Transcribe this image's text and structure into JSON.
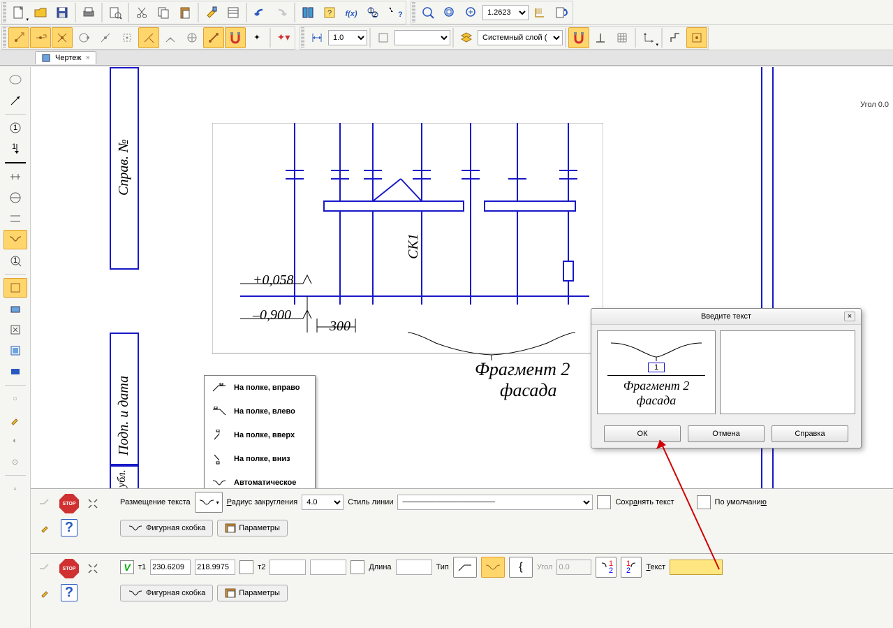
{
  "zoom_value": "1.2623",
  "linewidth_value": "1.0",
  "layer_value": "Системный слой (",
  "doc_tab": "Чертеж",
  "angle_text": "Угол 0.0",
  "drawing": {
    "label_ck1": "СК1",
    "elev1": "+0,058",
    "elev2": "–0,900",
    "dim300": "300",
    "fragment_l1": "Фрагмент 2",
    "fragment_l2": "фасада",
    "titlebox_sprav": "Справ. №",
    "titlebox_podp": "Подп. и дата",
    "titlebox_ubl": "убл."
  },
  "popup": {
    "i1": "На полке, вправо",
    "i2": "На полке, влево",
    "i3": "На полке, вверх",
    "i4": "На полке, вниз",
    "i5": "Автоматическое"
  },
  "panel1": {
    "razm": "Размещение текста",
    "radius_label": "Радиус закругления",
    "radius_val": "4.0",
    "style_label": "Стиль линии",
    "save_text": "Сохранять текст",
    "default": "По умолчанию",
    "tab1": "Фигурная скобка",
    "tab2": "Параметры"
  },
  "panel2": {
    "t1_label": "т1",
    "t1_x": "230.6209",
    "t1_y": "218.9975",
    "t2_label": "т2",
    "dlina": "Длина",
    "tip": "Тип",
    "ugol": "Угол",
    "ugol_val": "0.0",
    "text_label": "Текст",
    "tab1": "Фигурная скобка",
    "tab2": "Параметры"
  },
  "dialog": {
    "title": "Введите текст",
    "preview_num": "1",
    "preview_l1": "Фрагмент 2",
    "preview_l2": "фасада",
    "ok": "ОК",
    "cancel": "Отмена",
    "help": "Справка"
  },
  "stop": "STOP"
}
